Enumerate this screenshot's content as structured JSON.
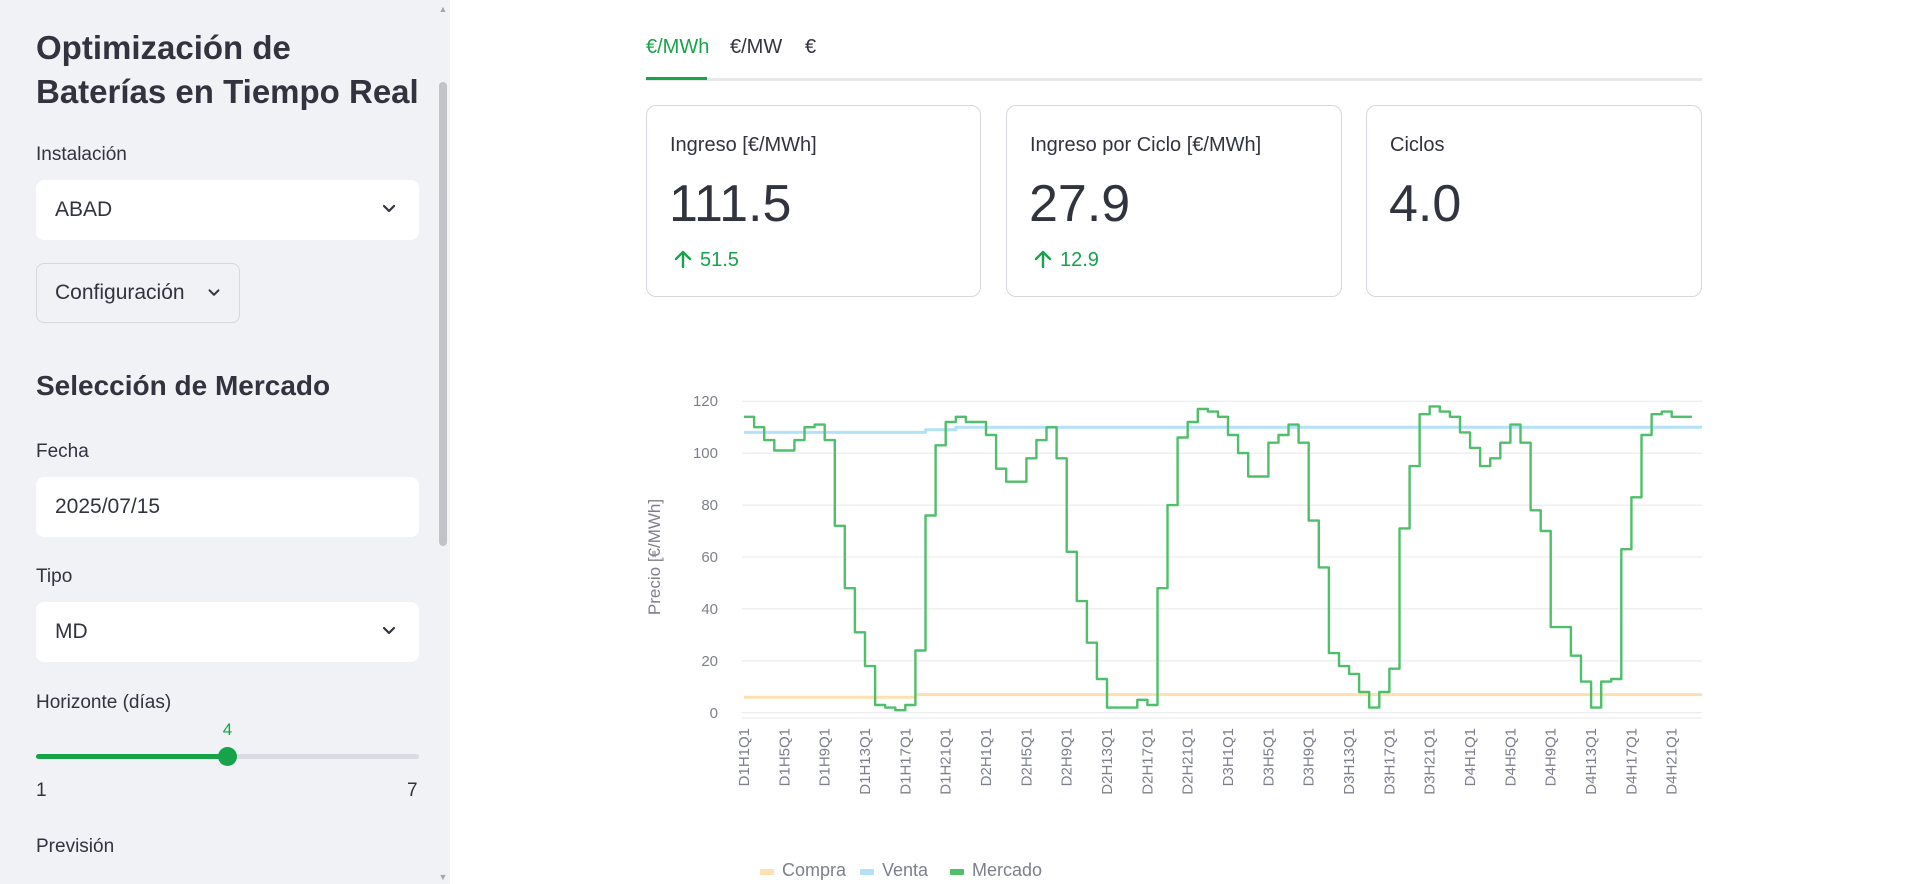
{
  "sidebar": {
    "title": "Optimización de Baterías en Tiempo Real",
    "installation": {
      "label": "Instalación",
      "value": "ABAD"
    },
    "config_label": "Configuración",
    "market_heading": "Selección de Mercado",
    "date": {
      "label": "Fecha",
      "value": "2025/07/15"
    },
    "type": {
      "label": "Tipo",
      "value": "MD"
    },
    "horizon": {
      "label": "Horizonte (días)",
      "value": 4,
      "value_label": "4",
      "min": "1",
      "max": "7"
    },
    "forecast_label": "Previsión"
  },
  "tabs": [
    {
      "label": "€/MWh",
      "active": true
    },
    {
      "label": "€/MW",
      "active": false
    },
    {
      "label": "€",
      "active": false
    }
  ],
  "metrics": [
    {
      "label": "Ingreso [€/MWh]",
      "value": "111.5",
      "delta": "51.5"
    },
    {
      "label": "Ingreso por Ciclo [€/MWh]",
      "value": "27.9",
      "delta": "12.9"
    },
    {
      "label": "Ciclos",
      "value": "4.0",
      "delta": ""
    }
  ],
  "colors": {
    "accent": "#16a34a",
    "compra": "#fde0b0",
    "venta": "#b3e2f8",
    "mercado": "#4fbf6a"
  },
  "chart_data": {
    "type": "line",
    "ylabel": "Precio [€/MWh]",
    "ylim": [
      -2,
      122
    ],
    "yticks": [
      0,
      20,
      40,
      60,
      80,
      100,
      120
    ],
    "x": [
      "D1H1Q1",
      "D1H2Q1",
      "D1H3Q1",
      "D1H4Q1",
      "D1H5Q1",
      "D1H6Q1",
      "D1H7Q1",
      "D1H8Q1",
      "D1H9Q1",
      "D1H10Q1",
      "D1H11Q1",
      "D1H12Q1",
      "D1H13Q1",
      "D1H14Q1",
      "D1H15Q1",
      "D1H16Q1",
      "D1H17Q1",
      "D1H18Q1",
      "D1H19Q1",
      "D1H20Q1",
      "D1H21Q1",
      "D1H22Q1",
      "D1H23Q1",
      "D1H24Q1",
      "D2H1Q1",
      "D2H2Q1",
      "D2H3Q1",
      "D2H4Q1",
      "D2H5Q1",
      "D2H6Q1",
      "D2H7Q1",
      "D2H8Q1",
      "D2H9Q1",
      "D2H10Q1",
      "D2H11Q1",
      "D2H12Q1",
      "D2H13Q1",
      "D2H14Q1",
      "D2H15Q1",
      "D2H16Q1",
      "D2H17Q1",
      "D2H18Q1",
      "D2H19Q1",
      "D2H20Q1",
      "D2H21Q1",
      "D2H22Q1",
      "D2H23Q1",
      "D2H24Q1",
      "D3H1Q1",
      "D3H2Q1",
      "D3H3Q1",
      "D3H4Q1",
      "D3H5Q1",
      "D3H6Q1",
      "D3H7Q1",
      "D3H8Q1",
      "D3H9Q1",
      "D3H10Q1",
      "D3H11Q1",
      "D3H12Q1",
      "D3H13Q1",
      "D3H14Q1",
      "D3H15Q1",
      "D3H16Q1",
      "D3H17Q1",
      "D3H18Q1",
      "D3H19Q1",
      "D3H20Q1",
      "D3H21Q1",
      "D3H22Q1",
      "D3H23Q1",
      "D3H24Q1",
      "D4H1Q1",
      "D4H2Q1",
      "D4H3Q1",
      "D4H4Q1",
      "D4H5Q1",
      "D4H6Q1",
      "D4H7Q1",
      "D4H8Q1",
      "D4H9Q1",
      "D4H10Q1",
      "D4H11Q1",
      "D4H12Q1",
      "D4H13Q1",
      "D4H14Q1",
      "D4H15Q1",
      "D4H16Q1",
      "D4H17Q1",
      "D4H18Q1",
      "D4H19Q1",
      "D4H20Q1",
      "D4H21Q1",
      "D4H22Q1",
      "D4H23Q1",
      "D4H24Q1"
    ],
    "xtick_labels": [
      "D1H1Q1",
      "D1H5Q1",
      "D1H9Q1",
      "D1H13Q1",
      "D1H17Q1",
      "D1H21Q1",
      "D2H1Q1",
      "D2H5Q1",
      "D2H9Q1",
      "D2H13Q1",
      "D2H17Q1",
      "D2H21Q1",
      "D3H1Q1",
      "D3H5Q1",
      "D3H9Q1",
      "D3H13Q1",
      "D3H17Q1",
      "D3H21Q1",
      "D4H1Q1",
      "D4H5Q1",
      "D4H9Q1",
      "D4H13Q1",
      "D4H17Q1",
      "D4H21Q1"
    ],
    "series": [
      {
        "name": "Compra",
        "values": [
          6,
          6,
          6,
          6,
          6,
          6,
          6,
          6,
          6,
          6,
          6,
          6,
          6,
          6,
          6,
          6,
          6,
          7,
          7,
          7,
          7,
          7,
          7,
          7,
          7,
          7,
          7,
          7,
          7,
          7,
          7,
          7,
          7,
          7,
          7,
          7,
          7,
          7,
          7,
          7,
          7,
          7,
          7,
          7,
          7,
          7,
          7,
          7,
          7,
          7,
          7,
          7,
          7,
          7,
          7,
          7,
          7,
          7,
          7,
          7,
          7,
          7,
          7,
          7,
          7,
          7,
          7,
          7,
          7,
          7,
          7,
          7,
          7,
          7,
          7,
          7,
          7,
          7,
          7,
          7,
          7,
          7,
          7,
          7,
          7,
          7,
          7,
          7,
          7,
          7,
          7,
          7,
          7,
          7,
          7,
          7
        ]
      },
      {
        "name": "Venta",
        "values": [
          108,
          108,
          108,
          108,
          108,
          108,
          108,
          108,
          108,
          108,
          108,
          108,
          108,
          108,
          108,
          108,
          108,
          108,
          109,
          109,
          109,
          110,
          110,
          110,
          110,
          110,
          110,
          110,
          110,
          110,
          110,
          110,
          110,
          110,
          110,
          110,
          110,
          110,
          110,
          110,
          110,
          110,
          110,
          110,
          110,
          110,
          110,
          110,
          110,
          110,
          110,
          110,
          110,
          110,
          110,
          110,
          110,
          110,
          110,
          110,
          110,
          110,
          110,
          110,
          110,
          110,
          110,
          110,
          110,
          110,
          110,
          110,
          110,
          110,
          110,
          110,
          110,
          110,
          110,
          110,
          110,
          110,
          110,
          110,
          110,
          110,
          110,
          110,
          110,
          110,
          110,
          110,
          110,
          110,
          110,
          110
        ]
      },
      {
        "name": "Mercado",
        "values": [
          114,
          110,
          105,
          101,
          101,
          105,
          110,
          111,
          105,
          72,
          48,
          31,
          18,
          3,
          2,
          1,
          3,
          24,
          76,
          103,
          112,
          114,
          112,
          112,
          107,
          94,
          89,
          89,
          98,
          105,
          110,
          98,
          62,
          43,
          27,
          13,
          2,
          2,
          2,
          5,
          3,
          48,
          80,
          106,
          112,
          117,
          116,
          114,
          107,
          100,
          91,
          91,
          104,
          107,
          111,
          104,
          74,
          56,
          23,
          18,
          15,
          8,
          2,
          8,
          17,
          71,
          95,
          115,
          118,
          116,
          114,
          108,
          102,
          95,
          98,
          104,
          111,
          104,
          78,
          70,
          33,
          33,
          22,
          12,
          2,
          12,
          13,
          63,
          83,
          107,
          115,
          116,
          114,
          114
        ]
      }
    ],
    "legend_position": "bottom"
  }
}
